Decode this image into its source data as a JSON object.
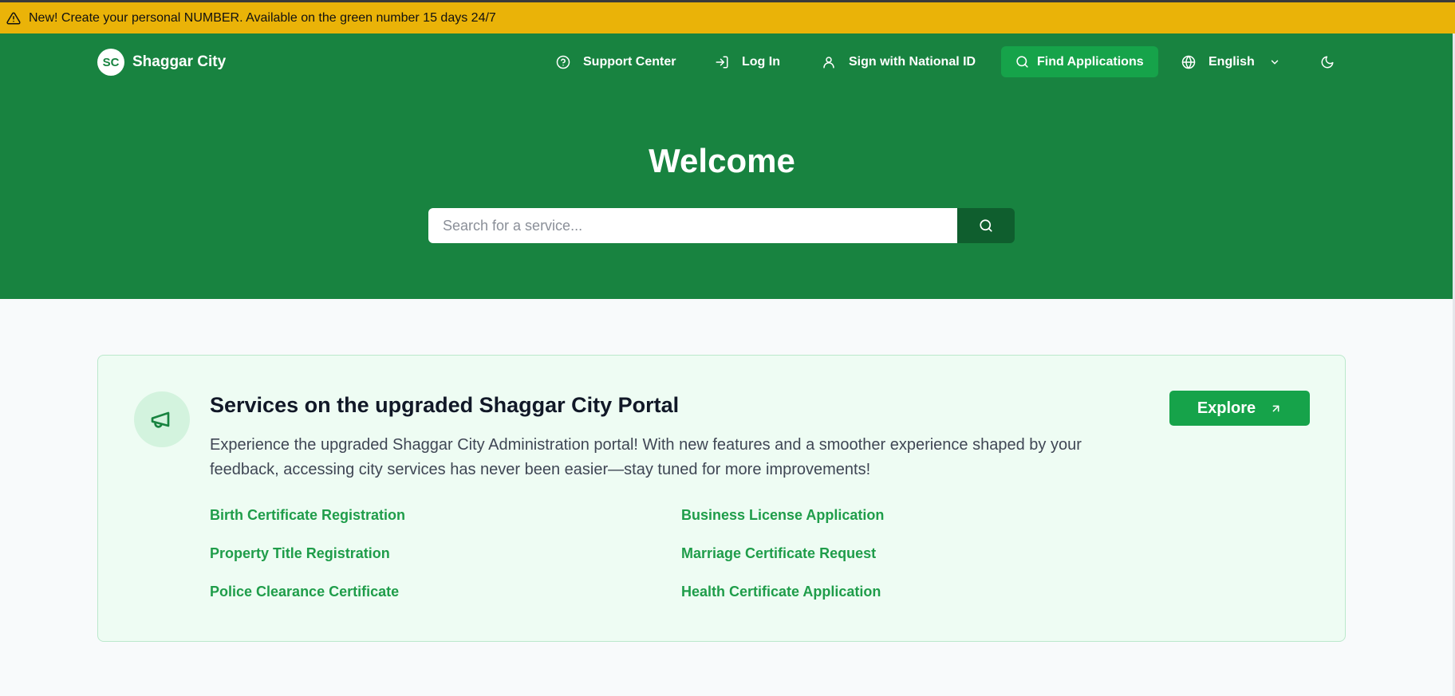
{
  "announcement": {
    "icon": "warning-triangle-icon",
    "text": "New! Create your personal NUMBER. Available on the green number 15 days 24/7",
    "color": "#eab308"
  },
  "header": {
    "logo_initials": "SC",
    "brand": "Shaggar City",
    "nav": {
      "support": "Support Center",
      "login": "Log In",
      "national_id": "Sign with National ID",
      "find": "Find Applications",
      "language": "English"
    }
  },
  "hero": {
    "title": "Welcome",
    "search_placeholder": "Search for a service...",
    "color": "#188340"
  },
  "announcement_card": {
    "title": "Services on the upgraded Shaggar City Portal",
    "description": "Experience the upgraded Shaggar City Administration portal! With new features and a smoother experience shaped by your feedback, accessing city services has never been easier—stay tuned for more improvements!",
    "explore_label": "Explore",
    "services": [
      "Birth Certificate Registration",
      "Business License Application",
      "Property Title Registration",
      "Marriage Certificate Request",
      "Police Clearance Certificate",
      "Health Certificate Application"
    ]
  },
  "colors": {
    "accent": "#16a34a",
    "link": "#1f9d4a"
  }
}
